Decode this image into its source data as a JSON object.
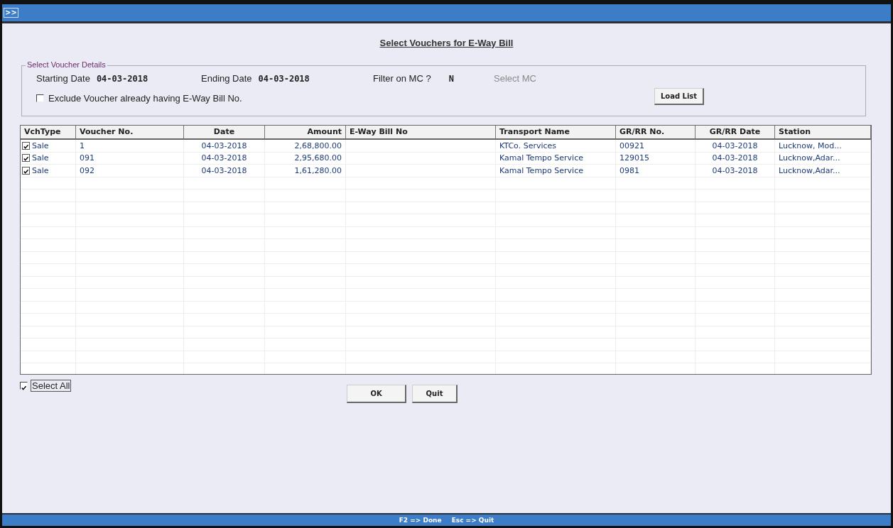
{
  "title_bar": {
    "menu_glyph": ">>"
  },
  "heading": "Select Vouchers for E-Way Bill",
  "voucher_details": {
    "legend": "Select Voucher Details",
    "fields": [
      {
        "label": "Starting Date",
        "value": "04-03-2018"
      },
      {
        "label": "Ending Date",
        "value": "04-03-2018"
      },
      {
        "label": "Filter on MC ?",
        "value": "N"
      }
    ],
    "select_mc": {
      "label": "Select MC",
      "disabled": true
    },
    "exclude_checkbox": {
      "label": "Exclude Voucher already having E-Way Bill No.",
      "checked": false
    },
    "load_button": "Load List"
  },
  "table": {
    "columns": [
      "VchType",
      "Voucher No.",
      "Date",
      "Amount",
      "E-Way Bill No",
      "Transport Name",
      "GR/RR No.",
      "GR/RR Date",
      "Station"
    ],
    "rows": [
      {
        "checked": true,
        "vch_type": "Sale",
        "voucher_no": "1",
        "date": "04-03-2018",
        "amount": "2,68,800.00",
        "transport_name": "KTCo. Services",
        "gr_rr_no": "00921",
        "gr_rr_date": "04-03-2018",
        "station": "Lucknow, Mod..."
      },
      {
        "checked": true,
        "vch_type": "Sale",
        "voucher_no": "091",
        "date": "04-03-2018",
        "amount": "2,95,680.00",
        "transport_name": "Kamal Tempo Service",
        "gr_rr_no": "129015",
        "gr_rr_date": "04-03-2018",
        "station": "Lucknow,Adar..."
      },
      {
        "checked": true,
        "vch_type": "Sale",
        "voucher_no": "092",
        "date": "04-03-2018",
        "amount": "1,61,280.00",
        "transport_name": "Kamal Tempo Service",
        "gr_rr_no": "0981",
        "gr_rr_date": "04-03-2018",
        "station": "Lucknow,Adar..."
      }
    ]
  },
  "select_all": {
    "label": "Select All",
    "checked": true
  },
  "buttons": [
    "OK",
    "Quit"
  ],
  "status_bar": [
    "F2 => Done",
    "Esc => Quit"
  ]
}
